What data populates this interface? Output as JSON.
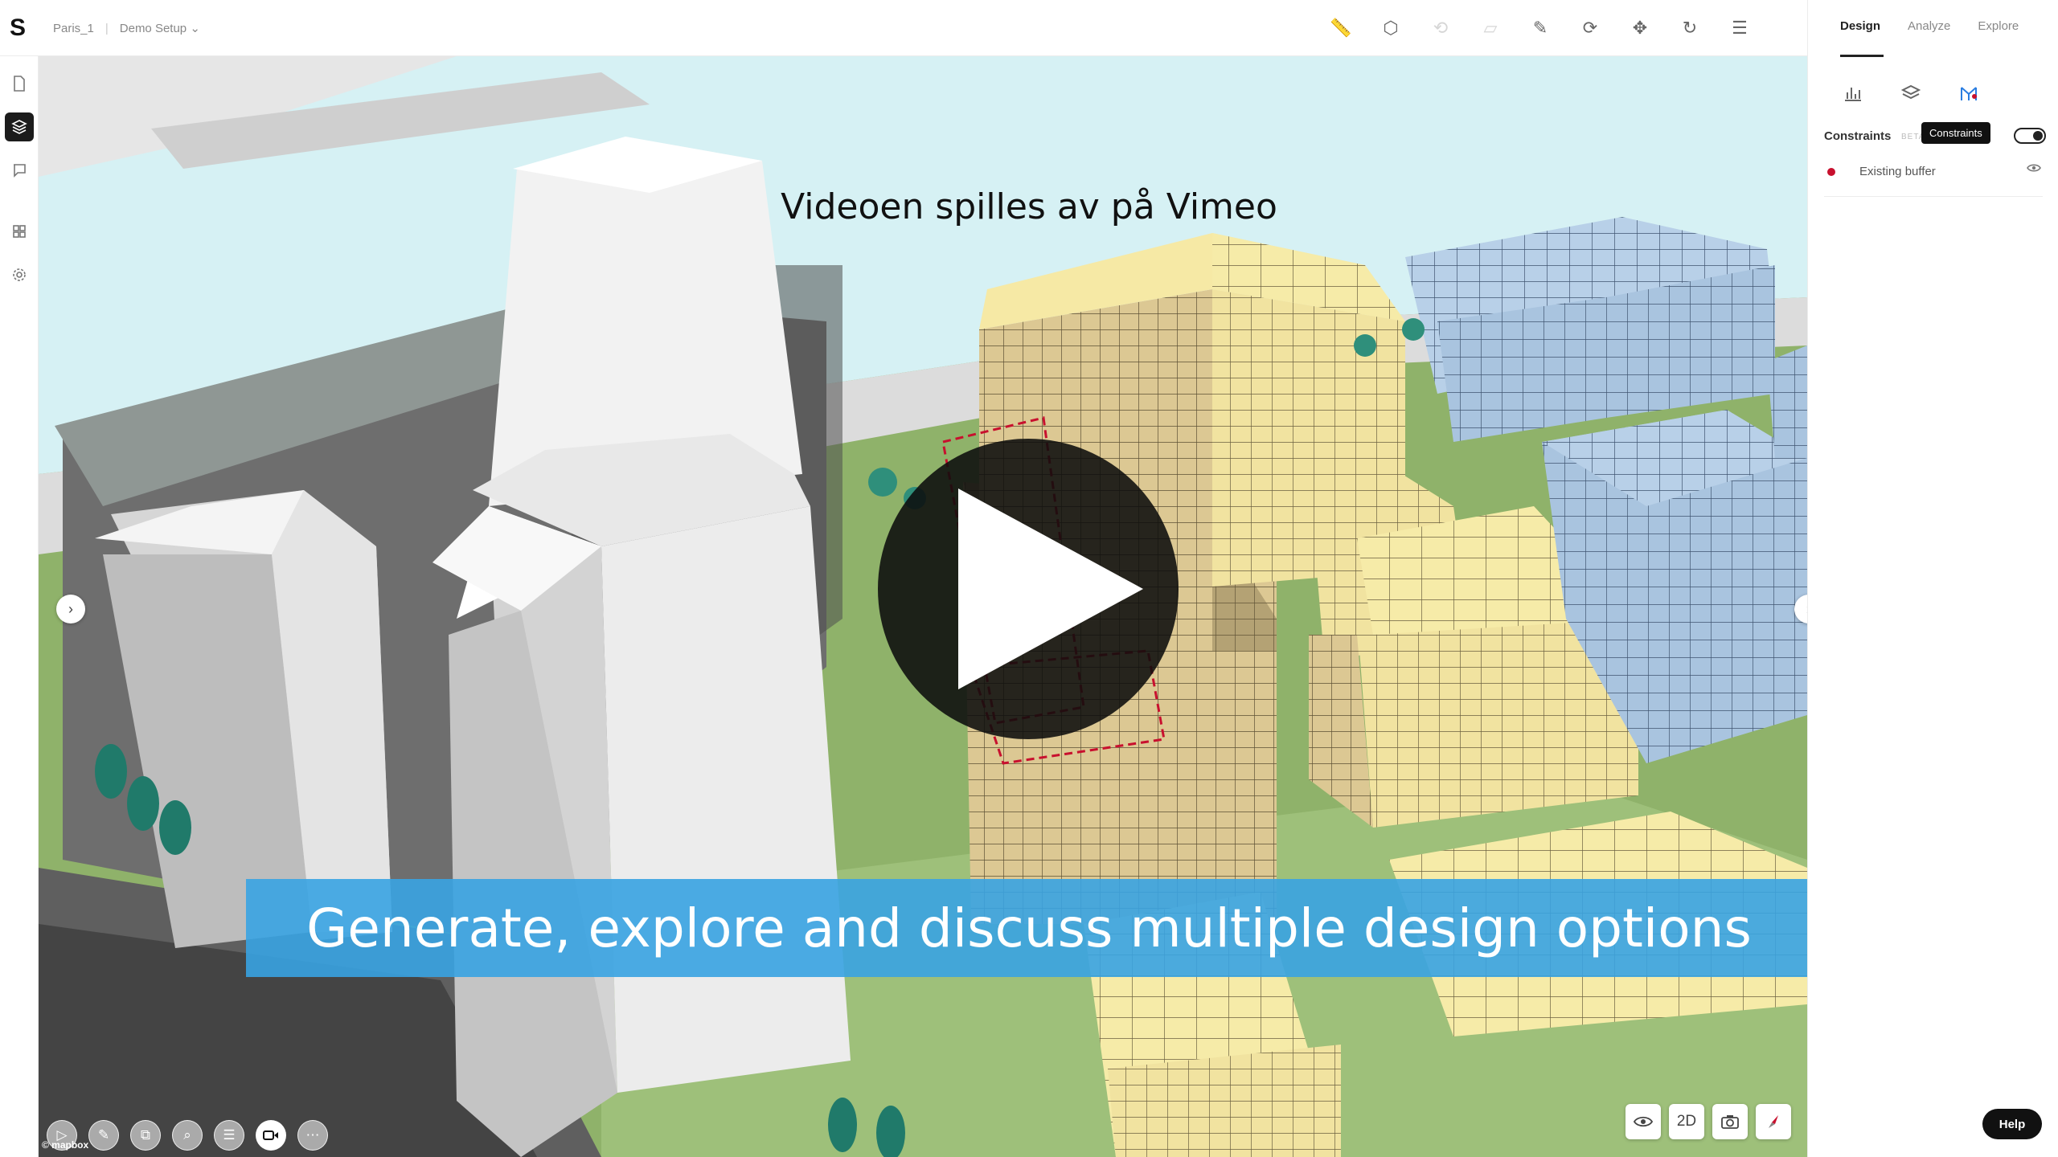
{
  "app": {
    "logo": "S",
    "breadcrumb": [
      "Paris_1",
      "Demo Setup"
    ]
  },
  "toolbar": {
    "tools": [
      {
        "icon": "ruler-icon",
        "glyph": "📏",
        "enabled": true
      },
      {
        "icon": "cube-icon",
        "glyph": "⬡",
        "enabled": true
      },
      {
        "icon": "undo-shape-icon",
        "glyph": "⟲",
        "enabled": false
      },
      {
        "icon": "polygon-icon",
        "glyph": "▱",
        "enabled": false
      },
      {
        "icon": "draw-shape-icon",
        "glyph": "✎",
        "enabled": true
      },
      {
        "icon": "rotate-icon",
        "glyph": "⟳",
        "enabled": true
      },
      {
        "icon": "move-icon",
        "glyph": "✥",
        "enabled": true
      },
      {
        "icon": "refresh-icon",
        "glyph": "↻",
        "enabled": true
      },
      {
        "icon": "settings-sliders-icon",
        "glyph": "☰",
        "enabled": true
      }
    ]
  },
  "right_panel": {
    "tabs": [
      "Design",
      "Analyze",
      "Explore"
    ],
    "active_tab": "Design",
    "tooltip": "Constraints",
    "constraints_label": "Constraints",
    "beta_label": "BETA",
    "constraints_enabled": true,
    "items": [
      {
        "label": "Existing buffer",
        "color": "#c8102e"
      }
    ],
    "help_label": "Help"
  },
  "video": {
    "title": "Videoen spilles av på Vimeo",
    "caption": "Generate, explore and discuss multiple design options"
  },
  "view_controls": {
    "mode_label": "2D"
  },
  "attribution": "© mapbox"
}
